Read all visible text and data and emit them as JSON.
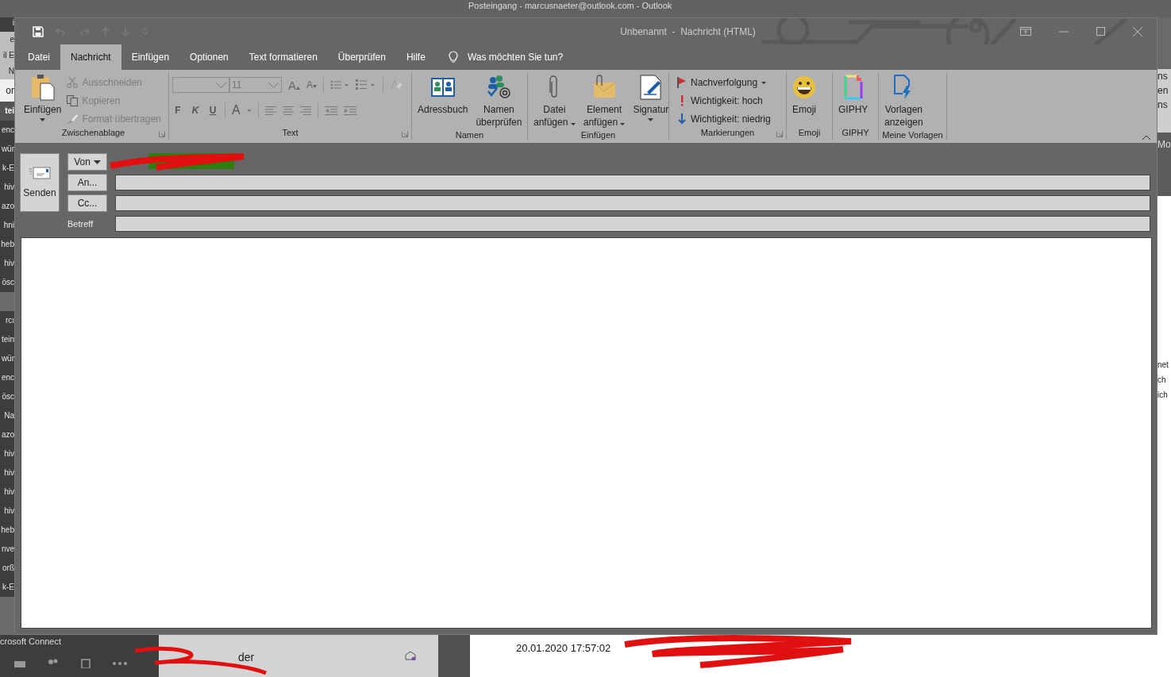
{
  "background_window": {
    "title": "Posteingang - marcusnaeter@outlook.com - Outlook",
    "left_fragments": [
      {
        "text": "i",
        "selected": false
      },
      {
        "text": "e",
        "selected": false
      },
      {
        "text": "il E",
        "selected": false
      },
      {
        "text": "N",
        "selected": false
      },
      {
        "text": "or",
        "selected": false
      },
      {
        "text": "tei",
        "selected": true
      },
      {
        "text": "enc",
        "selected": false
      },
      {
        "text": "wür",
        "selected": false
      },
      {
        "text": "k-E",
        "selected": false
      },
      {
        "text": "hiv",
        "selected": false
      },
      {
        "text": "azo",
        "selected": false
      },
      {
        "text": "hni",
        "selected": false
      },
      {
        "text": "heb",
        "selected": false
      },
      {
        "text": "hiv",
        "selected": false
      },
      {
        "text": "ösc",
        "selected": false
      },
      {
        "text": "rcı",
        "selected": false
      },
      {
        "text": "tein",
        "selected": false
      },
      {
        "text": "wür",
        "selected": false
      },
      {
        "text": "enc",
        "selected": false
      },
      {
        "text": "ösc",
        "selected": false
      },
      {
        "text": "Na",
        "selected": false
      },
      {
        "text": "azo",
        "selected": false
      },
      {
        "text": "hiv",
        "selected": false
      },
      {
        "text": "hiv",
        "selected": false
      },
      {
        "text": "hiv",
        "selected": false
      },
      {
        "text": "hiv",
        "selected": false
      },
      {
        "text": "heb",
        "selected": false
      },
      {
        "text": "nve",
        "selected": false
      },
      {
        "text": "orß",
        "selected": false
      },
      {
        "text": "k-E",
        "selected": false
      }
    ],
    "footer_item": "crosoft Connect",
    "right_fragments_top": [
      "ns",
      "en",
      "ns"
    ],
    "right_label": "Mo",
    "right_fragments_body": [
      "net",
      "ch",
      "ich"
    ],
    "list_item": "der",
    "timestamp": "20.01.2020 17:57:02"
  },
  "window": {
    "title": "Unbenannt  -  Nachricht (HTML)"
  },
  "tabs": [
    {
      "label": "Datei",
      "selected": false
    },
    {
      "label": "Nachricht",
      "selected": true
    },
    {
      "label": "Einfügen",
      "selected": false
    },
    {
      "label": "Optionen",
      "selected": false
    },
    {
      "label": "Text formatieren",
      "selected": false
    },
    {
      "label": "Überprüfen",
      "selected": false
    },
    {
      "label": "Hilfe",
      "selected": false
    }
  ],
  "tell_me": "Was möchten Sie tun?",
  "clipboard": {
    "label": "Zwischenablage",
    "paste": "Einfügen",
    "cut": "Ausschneiden",
    "copy": "Kopieren",
    "format_painter": "Format übertragen"
  },
  "text": {
    "label": "Text",
    "font_size": "11",
    "grow": "A",
    "shrink": "A",
    "bold": "F",
    "italic": "K",
    "underline": "U",
    "font_color": "A"
  },
  "names": {
    "label": "Namen",
    "address_book": "Adressbuch",
    "check_names": [
      "Namen",
      "überprüfen"
    ]
  },
  "insert": {
    "label": "Einfügen",
    "attach_file": [
      "Datei",
      "anfügen"
    ],
    "attach_item": [
      "Element",
      "anfügen"
    ],
    "signature": "Signatur"
  },
  "tags": {
    "label": "Markierungen",
    "follow_up": "Nachverfolgung",
    "high": "Wichtigkeit: hoch",
    "low": "Wichtigkeit: niedrig"
  },
  "emoji": {
    "label": "Emoji",
    "button": "Emoji"
  },
  "giphy": {
    "label": "GIPHY",
    "button": "GIPHY"
  },
  "templates": {
    "label": "Meine Vorlagen",
    "button": [
      "Vorlagen",
      "anzeigen"
    ]
  },
  "compose": {
    "send": "Senden",
    "from": "Von",
    "to": "An...",
    "cc": "Cc...",
    "subject_label": "Betreff"
  }
}
